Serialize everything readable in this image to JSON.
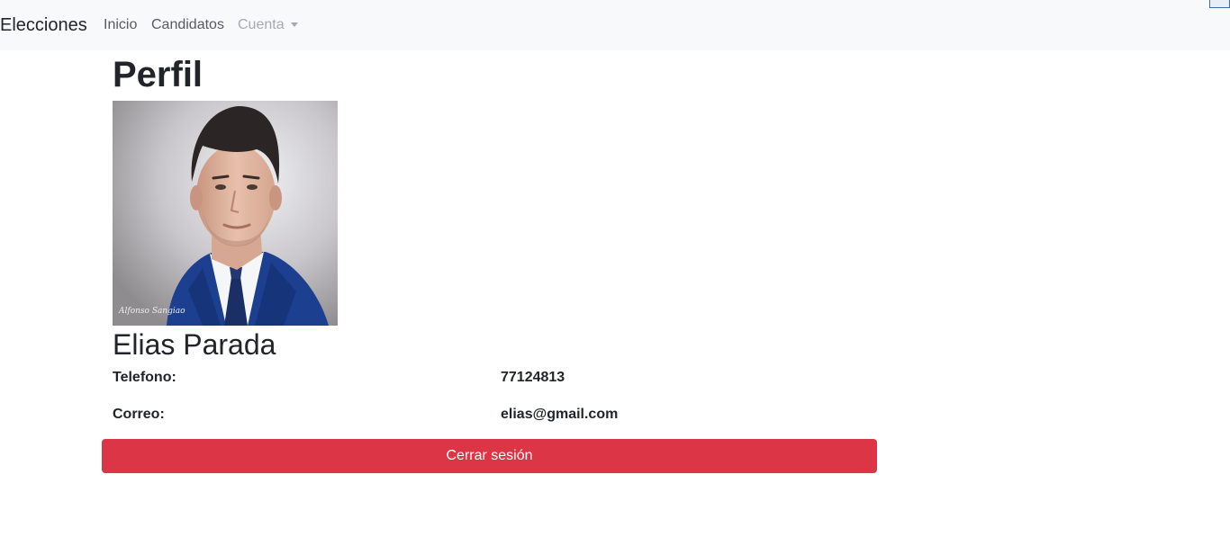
{
  "navbar": {
    "brand": "Elecciones",
    "links": [
      {
        "label": "Inicio"
      },
      {
        "label": "Candidatos"
      }
    ],
    "dropdown": {
      "label": "Cuenta",
      "icon": "caret-down-icon"
    }
  },
  "profile": {
    "title": "Perfil",
    "photo_watermark": "Alfonso Sangiao",
    "name": "Elias Parada",
    "fields": [
      {
        "label": "Telefono:",
        "value": "77124813"
      },
      {
        "label": "Correo:",
        "value": "elias@gmail.com"
      }
    ]
  },
  "actions": {
    "logout_label": "Cerrar sesión"
  },
  "colors": {
    "navbar_bg": "#f8f9fa",
    "danger": "#dc3545",
    "text": "#212529",
    "nav_muted": "#a6aaae"
  }
}
